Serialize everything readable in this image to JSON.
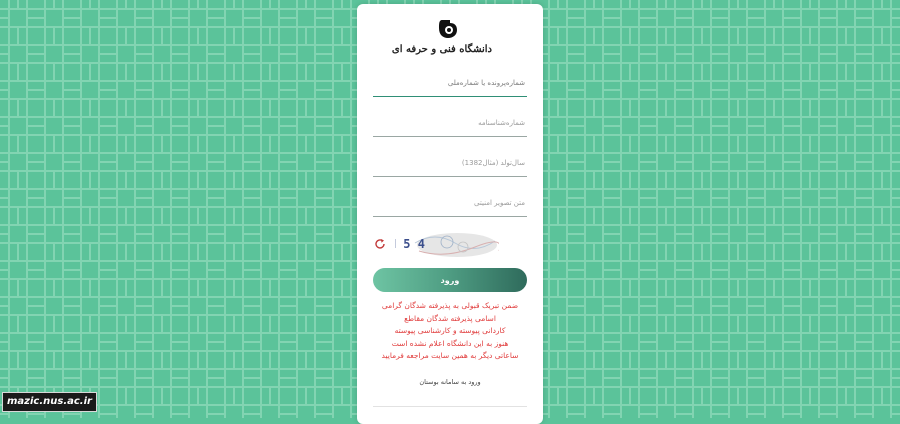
{
  "theme": {
    "background": "#5bc39a",
    "pattern_line": "#82d4b2",
    "accent": "#2f8f76",
    "notice_color": "#e03b3b"
  },
  "brand": {
    "logo_text": "دانشگاه فنی و حرفه ای",
    "logo_icon": "university-logo-icon"
  },
  "form": {
    "username_placeholder": "شماره‌پرونده یا شماره‌ملی",
    "id_number_placeholder": "شماره‌شناسنامه",
    "birth_year_placeholder": "سال‌تولد (مثال1382)",
    "captcha_placeholder": "متن تصویر امنیتی",
    "captcha_text": "4 5 H",
    "refresh_icon": "refresh-icon",
    "submit_label": "ورود"
  },
  "notice": {
    "lines": [
      "ضمن تبریک قبولی به پذیرفته شدگان گرامی",
      "اسامی پذیرفته شدگان مقاطع",
      "کاردانی پیوسته و کارشناسی پیوسته",
      "هنوز به این دانشگاه اعلام نشده است",
      "ساعاتی دیگر به همین سایت مراجعه فرمایید"
    ]
  },
  "footer": {
    "bustan_link": "ورود به سامانه بوستان"
  },
  "watermark": {
    "text": "mazic.nus.ac.ir"
  }
}
